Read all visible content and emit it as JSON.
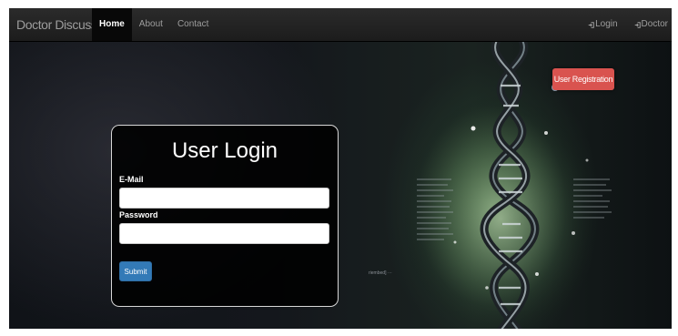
{
  "navbar": {
    "brand": "Doctor Discussion",
    "links": [
      {
        "label": "Home",
        "active": true
      },
      {
        "label": "About",
        "active": false
      },
      {
        "label": "Contact",
        "active": false
      }
    ],
    "right_links": [
      {
        "label": "Login",
        "icon": "log-in-icon"
      },
      {
        "label": "Doctor",
        "icon": "log-in-icon"
      }
    ]
  },
  "hero": {
    "register_button": "User Registration",
    "background_text": "riembed] ···"
  },
  "login_form": {
    "title": "User Login",
    "email_label": "E-Mail",
    "email_value": "",
    "password_label": "Password",
    "password_value": "",
    "submit_label": "Submit"
  },
  "colors": {
    "navbar_bg": "#222222",
    "danger": "#d9534f",
    "primary": "#337ab7"
  }
}
